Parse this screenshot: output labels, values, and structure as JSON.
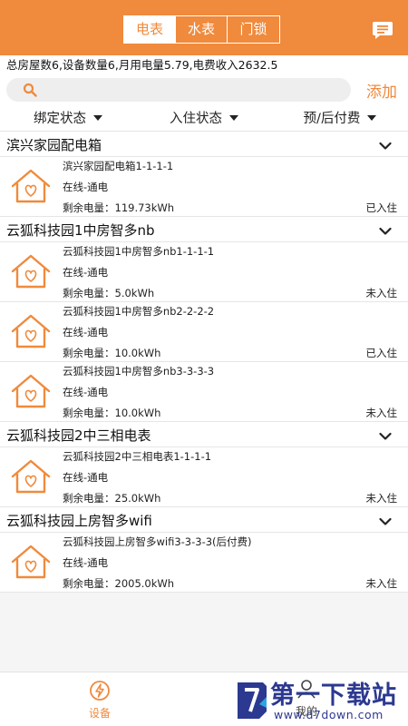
{
  "header": {
    "tabs": [
      {
        "label": "电表",
        "active": true
      },
      {
        "label": "水表",
        "active": false
      },
      {
        "label": "门锁",
        "active": false
      }
    ],
    "message_icon": "message-icon"
  },
  "summary": "总房屋数6,设备数量6,月用电量5.79,电费收入2632.5",
  "search": {
    "placeholder": "",
    "add_label": "添加"
  },
  "filters": [
    {
      "label": "绑定状态"
    },
    {
      "label": "入住状态"
    },
    {
      "label": "预/后付费"
    }
  ],
  "groups": [
    {
      "title": "滨兴家园配电箱",
      "devices": [
        {
          "name": "滨兴家园配电箱1-1-1-1",
          "status": "在线-通电",
          "remaining": "剩余电量：119.73kWh",
          "occupancy": "已入住"
        }
      ]
    },
    {
      "title": "云狐科技园1中房智多nb",
      "devices": [
        {
          "name": "云狐科技园1中房智多nb1-1-1-1",
          "status": "在线-通电",
          "remaining": "剩余电量：5.0kWh",
          "occupancy": "未入住"
        },
        {
          "name": "云狐科技园1中房智多nb2-2-2-2",
          "status": "在线-通电",
          "remaining": "剩余电量：10.0kWh",
          "occupancy": "已入住"
        },
        {
          "name": "云狐科技园1中房智多nb3-3-3-3",
          "status": "在线-通电",
          "remaining": "剩余电量：10.0kWh",
          "occupancy": "未入住"
        }
      ]
    },
    {
      "title": "云狐科技园2中三相电表",
      "devices": [
        {
          "name": "云狐科技园2中三相电表1-1-1-1",
          "status": "在线-通电",
          "remaining": "剩余电量：25.0kWh",
          "occupancy": "未入住"
        }
      ]
    },
    {
      "title": "云狐科技园上房智多wifi",
      "devices": [
        {
          "name": "云狐科技园上房智多wifi3-3-3-3(后付费)",
          "status": "在线-通电",
          "remaining": "剩余电量：2005.0kWh",
          "occupancy": "未入住"
        }
      ]
    }
  ],
  "bottom_nav": {
    "device_label": "设备",
    "mine_label": "我的"
  },
  "watermark": {
    "title": "第一下载站",
    "url": "www.d7down.com"
  },
  "colors": {
    "accent": "#f08a3c",
    "watermark": "#2c3990"
  }
}
